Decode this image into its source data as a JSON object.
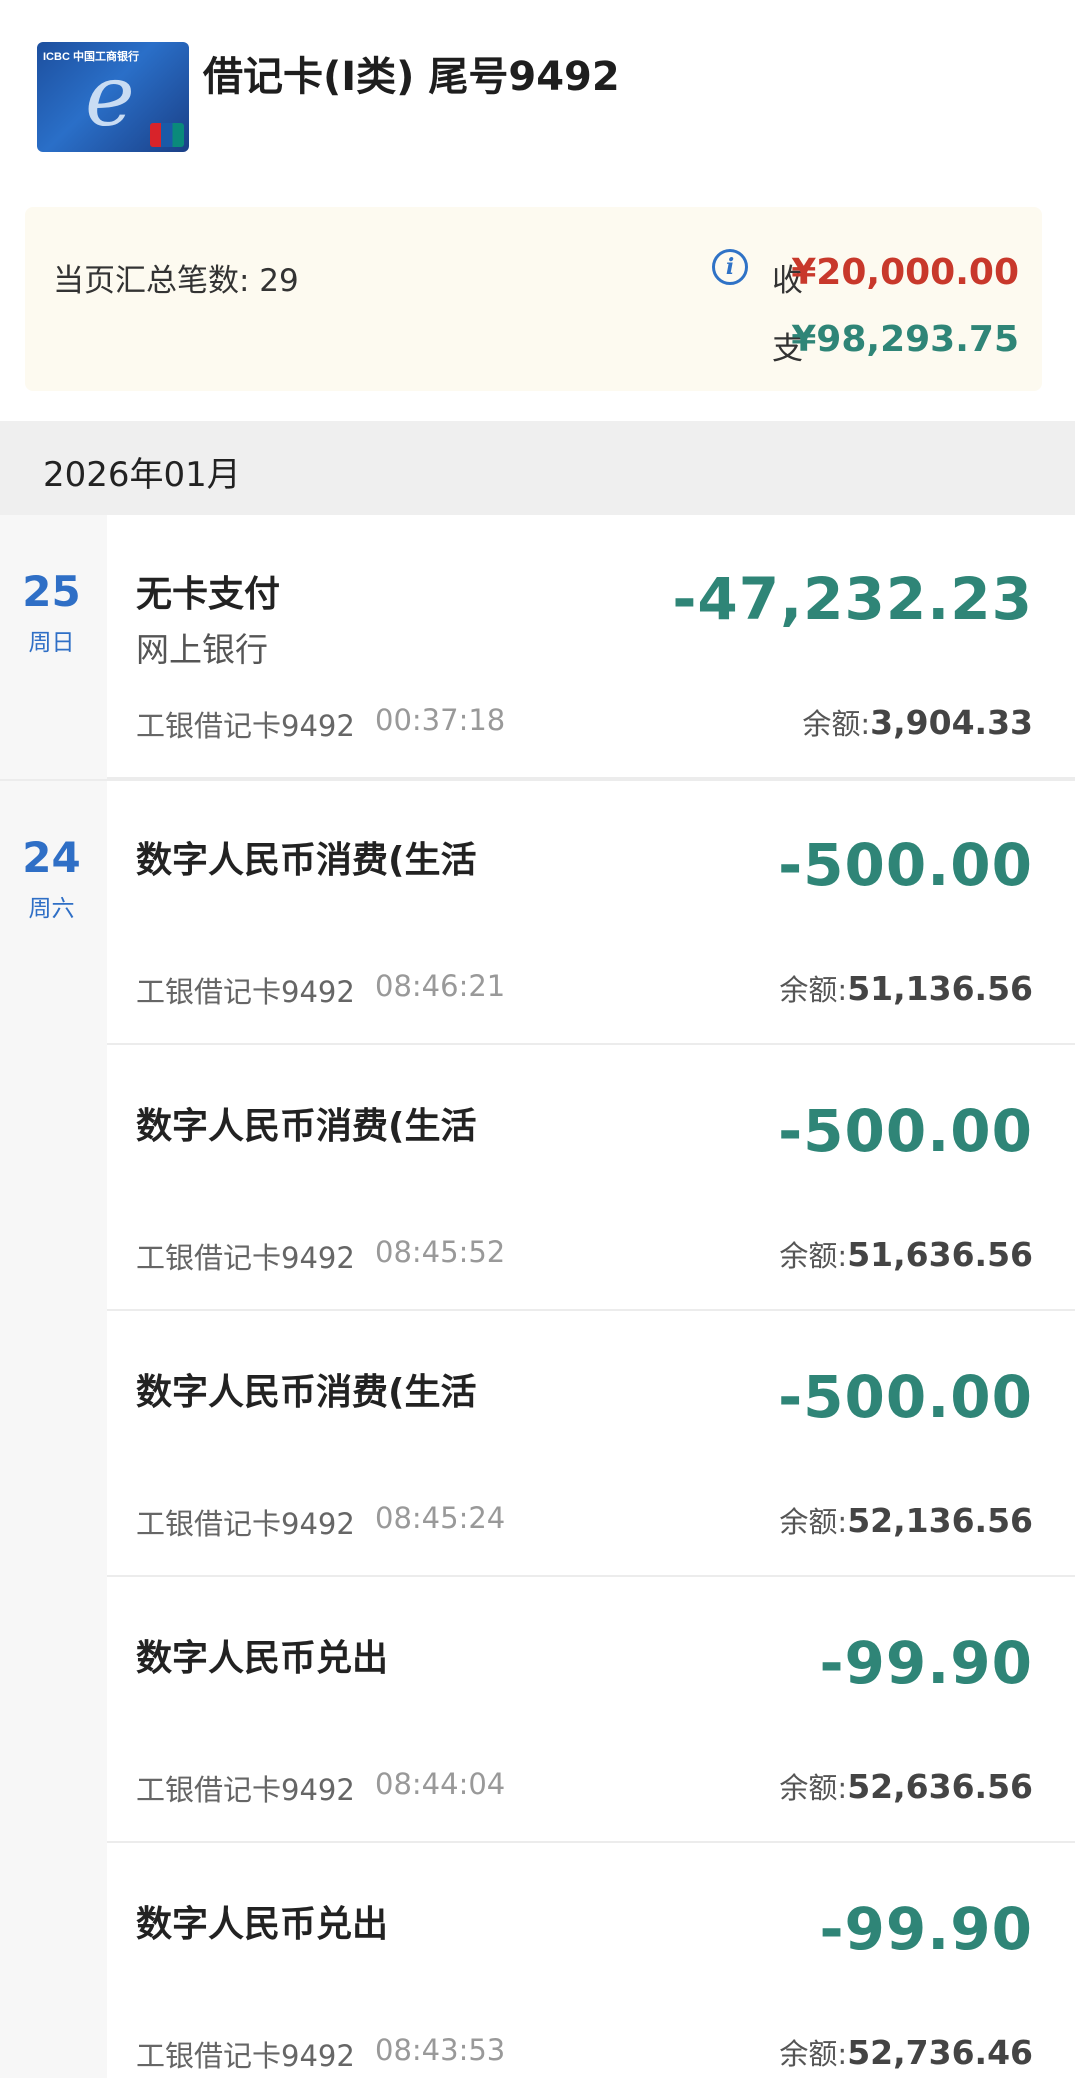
{
  "header": {
    "card_title": "借记卡(I类) 尾号9492",
    "card_brand_text": "ICBC 中国工商银行"
  },
  "summary": {
    "count_text": "当页汇总笔数: 29",
    "income_label": "收",
    "income_amount": "¥20,000.00",
    "expense_label": "支",
    "expense_amount": "¥98,293.75"
  },
  "month": {
    "label": "2026年01月"
  },
  "days": [
    {
      "day": "25",
      "weekday": "周日"
    },
    {
      "day": "24",
      "weekday": "周六"
    }
  ],
  "transactions": [
    {
      "title": "无卡支付",
      "subtitle": "网上银行",
      "amount": "-47,232.23",
      "card": "工银借记卡9492",
      "time": "00:37:18",
      "balance_label": "余额:",
      "balance": "3,904.33"
    },
    {
      "title": "数字人民币消费(生活",
      "subtitle": "",
      "amount": "-500.00",
      "card": "工银借记卡9492",
      "time": "08:46:21",
      "balance_label": "余额:",
      "balance": "51,136.56"
    },
    {
      "title": "数字人民币消费(生活",
      "subtitle": "",
      "amount": "-500.00",
      "card": "工银借记卡9492",
      "time": "08:45:52",
      "balance_label": "余额:",
      "balance": "51,636.56"
    },
    {
      "title": "数字人民币消费(生活",
      "subtitle": "",
      "amount": "-500.00",
      "card": "工银借记卡9492",
      "time": "08:45:24",
      "balance_label": "余额:",
      "balance": "52,136.56"
    },
    {
      "title": "数字人民币兑出",
      "subtitle": "",
      "amount": "-99.90",
      "card": "工银借记卡9492",
      "time": "08:44:04",
      "balance_label": "余额:",
      "balance": "52,636.56"
    },
    {
      "title": "数字人民币兑出",
      "subtitle": "",
      "amount": "-99.90",
      "card": "工银借记卡9492",
      "time": "08:43:53",
      "balance_label": "余额:",
      "balance": "52,736.46"
    }
  ],
  "colors": {
    "income": "#c8382b",
    "expense": "#2f8577",
    "accent": "#2f6fc6",
    "summary_bg": "#fdfaf0"
  }
}
